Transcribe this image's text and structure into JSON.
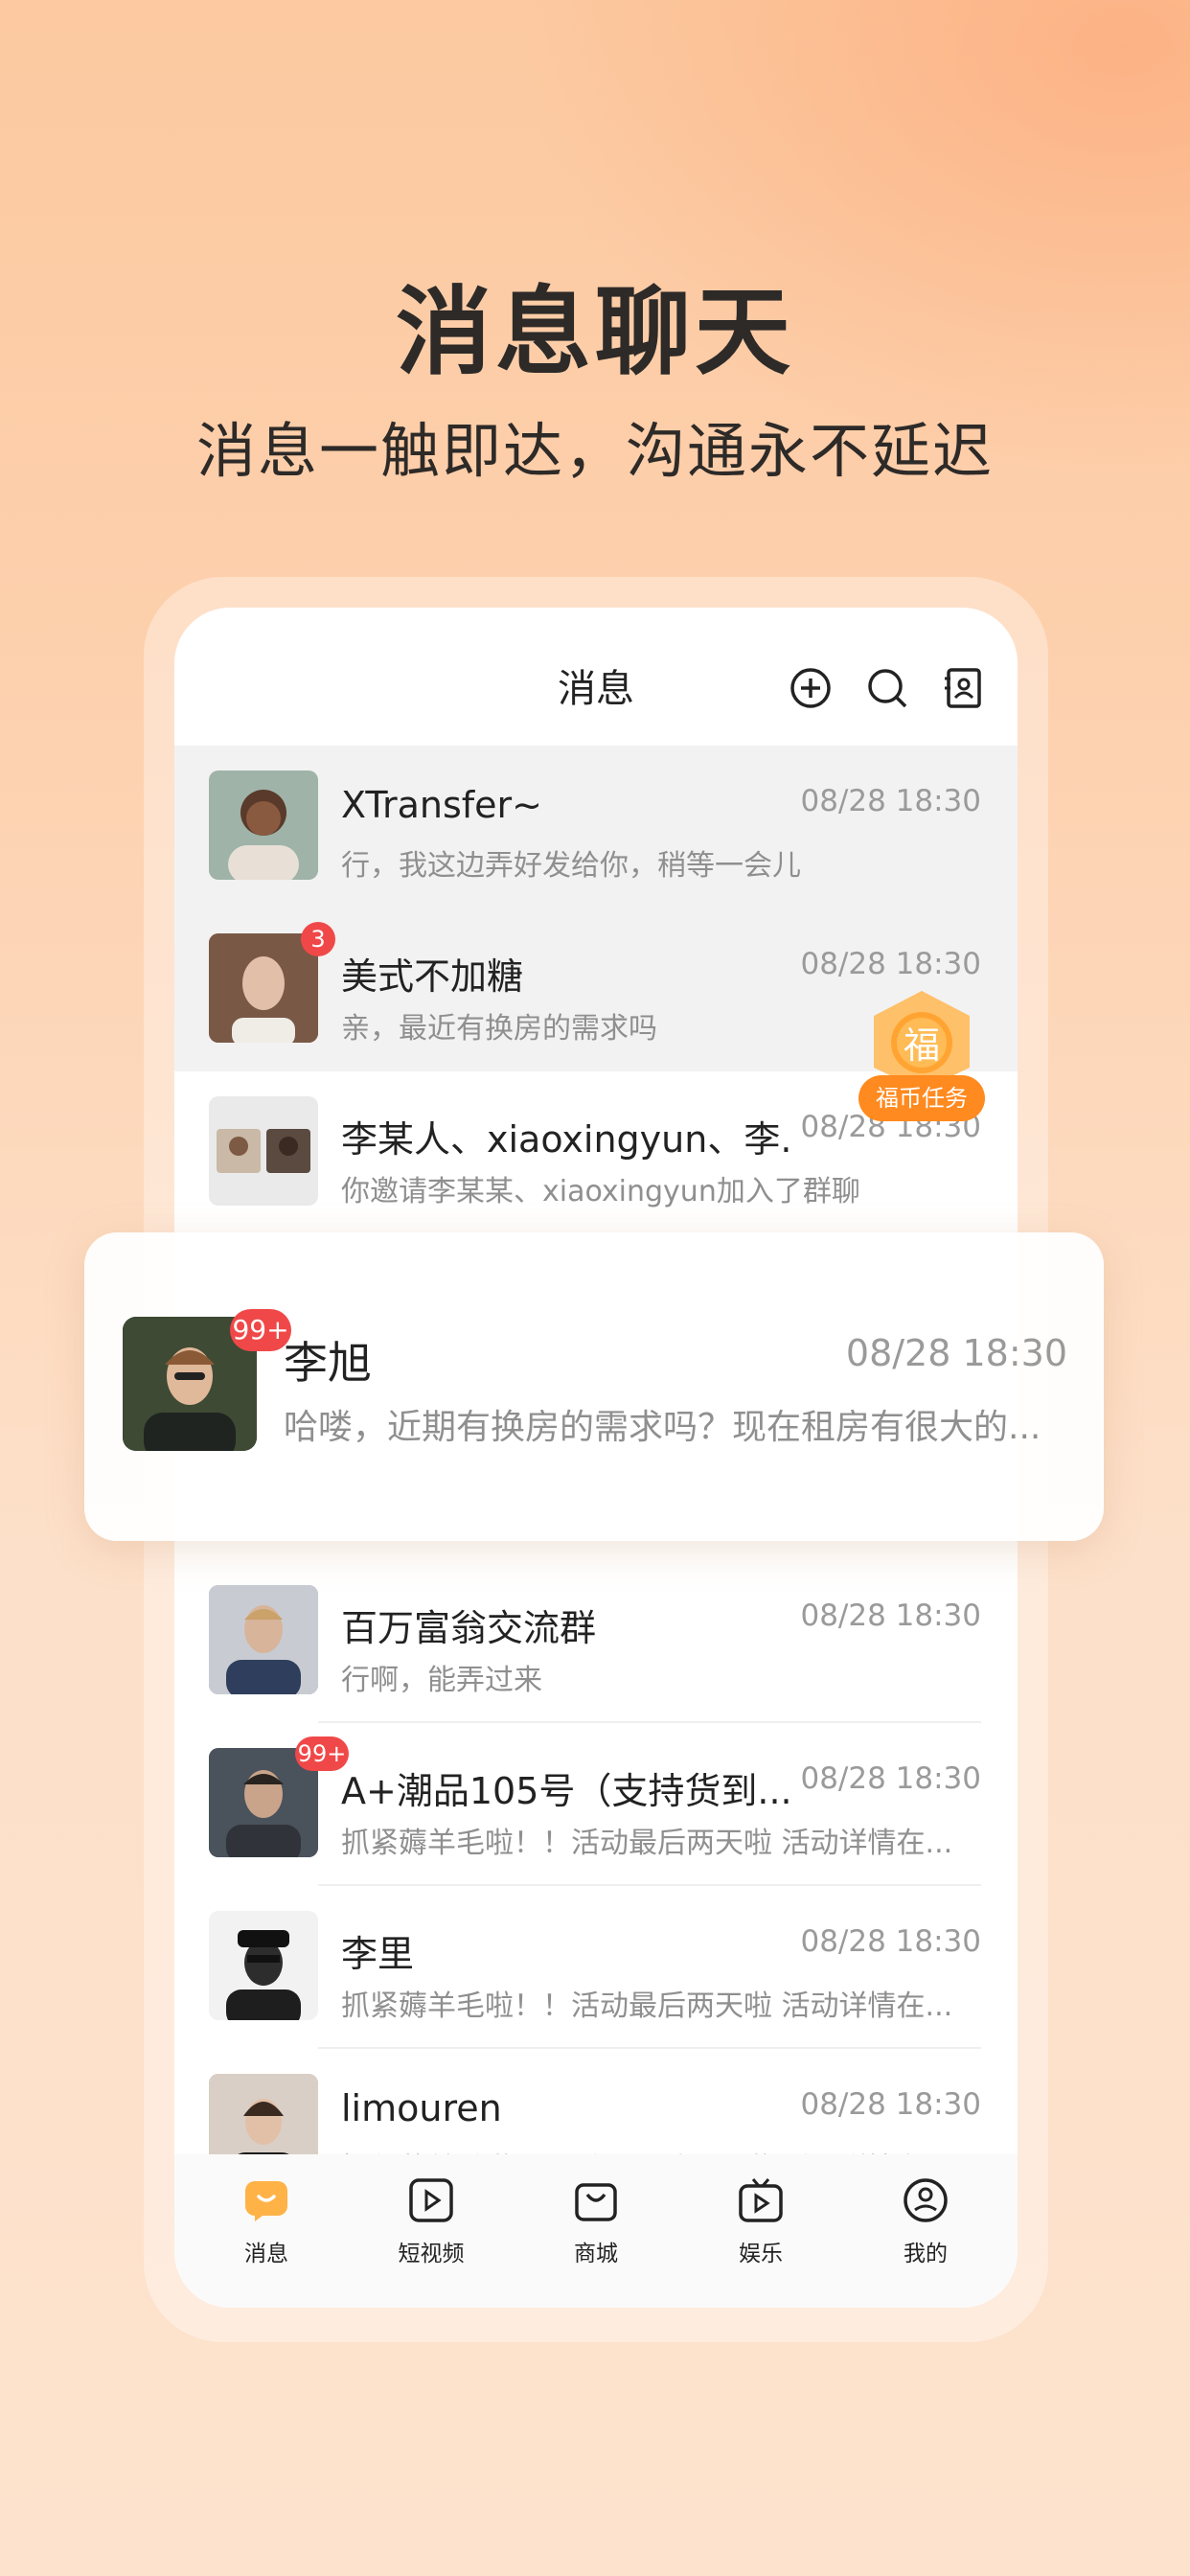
{
  "headline": "消息聊天",
  "subline": "消息一触即达，沟通永不延迟",
  "nav": {
    "title": "消息"
  },
  "conversations": [
    {
      "name": "XTransfer~",
      "time": "08/28  18:30",
      "preview": "行，我这边弄好发给你，稍等一会儿",
      "badge": "",
      "avatar_color": "#9fb3a8"
    },
    {
      "name": "美式不加糖",
      "time": "08/28  18:30",
      "preview": "亲，最近有换房的需求吗",
      "badge": "3",
      "avatar_color": "#8d6a57"
    },
    {
      "name": "李某人、xiaoxingyun、李...",
      "time": "08/28  18:30",
      "preview": "你邀请李某某、xiaoxingyun加入了群聊",
      "badge": "",
      "avatar_color": "#d9d9d9"
    },
    {
      "name": "百万富翁交流群",
      "time": "08/28  18:30",
      "preview": "行啊，能弄过来",
      "badge": "",
      "avatar_color": "#6d7f96"
    },
    {
      "name": "A+潮品105号（支持货到...",
      "time": "08/28  18:30",
      "preview": "抓紧薅羊毛啦！！活动最后两天啦  活动详情在...",
      "badge": "99+",
      "avatar_color": "#5b6470"
    },
    {
      "name": "李里",
      "time": "08/28  18:30",
      "preview": "抓紧薅羊毛啦！！活动最后两天啦  活动详情在...",
      "badge": "",
      "avatar_color": "#3a3a3a"
    },
    {
      "name": "limouren",
      "time": "08/28  18:30",
      "preview": "抓紧薅羊毛啦！！活动最后两天啦  活动详情在...",
      "badge": "",
      "avatar_color": "#b9a89a"
    }
  ],
  "highlight": {
    "name": "李旭",
    "time": "08/28  18:30",
    "preview": "哈喽，近期有换房的需求吗？现在租房有很大的...",
    "badge": "99+"
  },
  "reward": {
    "label": "福币任务",
    "glyph": "福"
  },
  "tabs": [
    {
      "label": "消息",
      "icon": "message-icon"
    },
    {
      "label": "短视频",
      "icon": "video-icon"
    },
    {
      "label": "商城",
      "icon": "shop-icon"
    },
    {
      "label": "娱乐",
      "icon": "tv-icon"
    },
    {
      "label": "我的",
      "icon": "profile-icon"
    }
  ],
  "colors": {
    "accent": "#ff8a1f",
    "badge": "#f04848"
  }
}
